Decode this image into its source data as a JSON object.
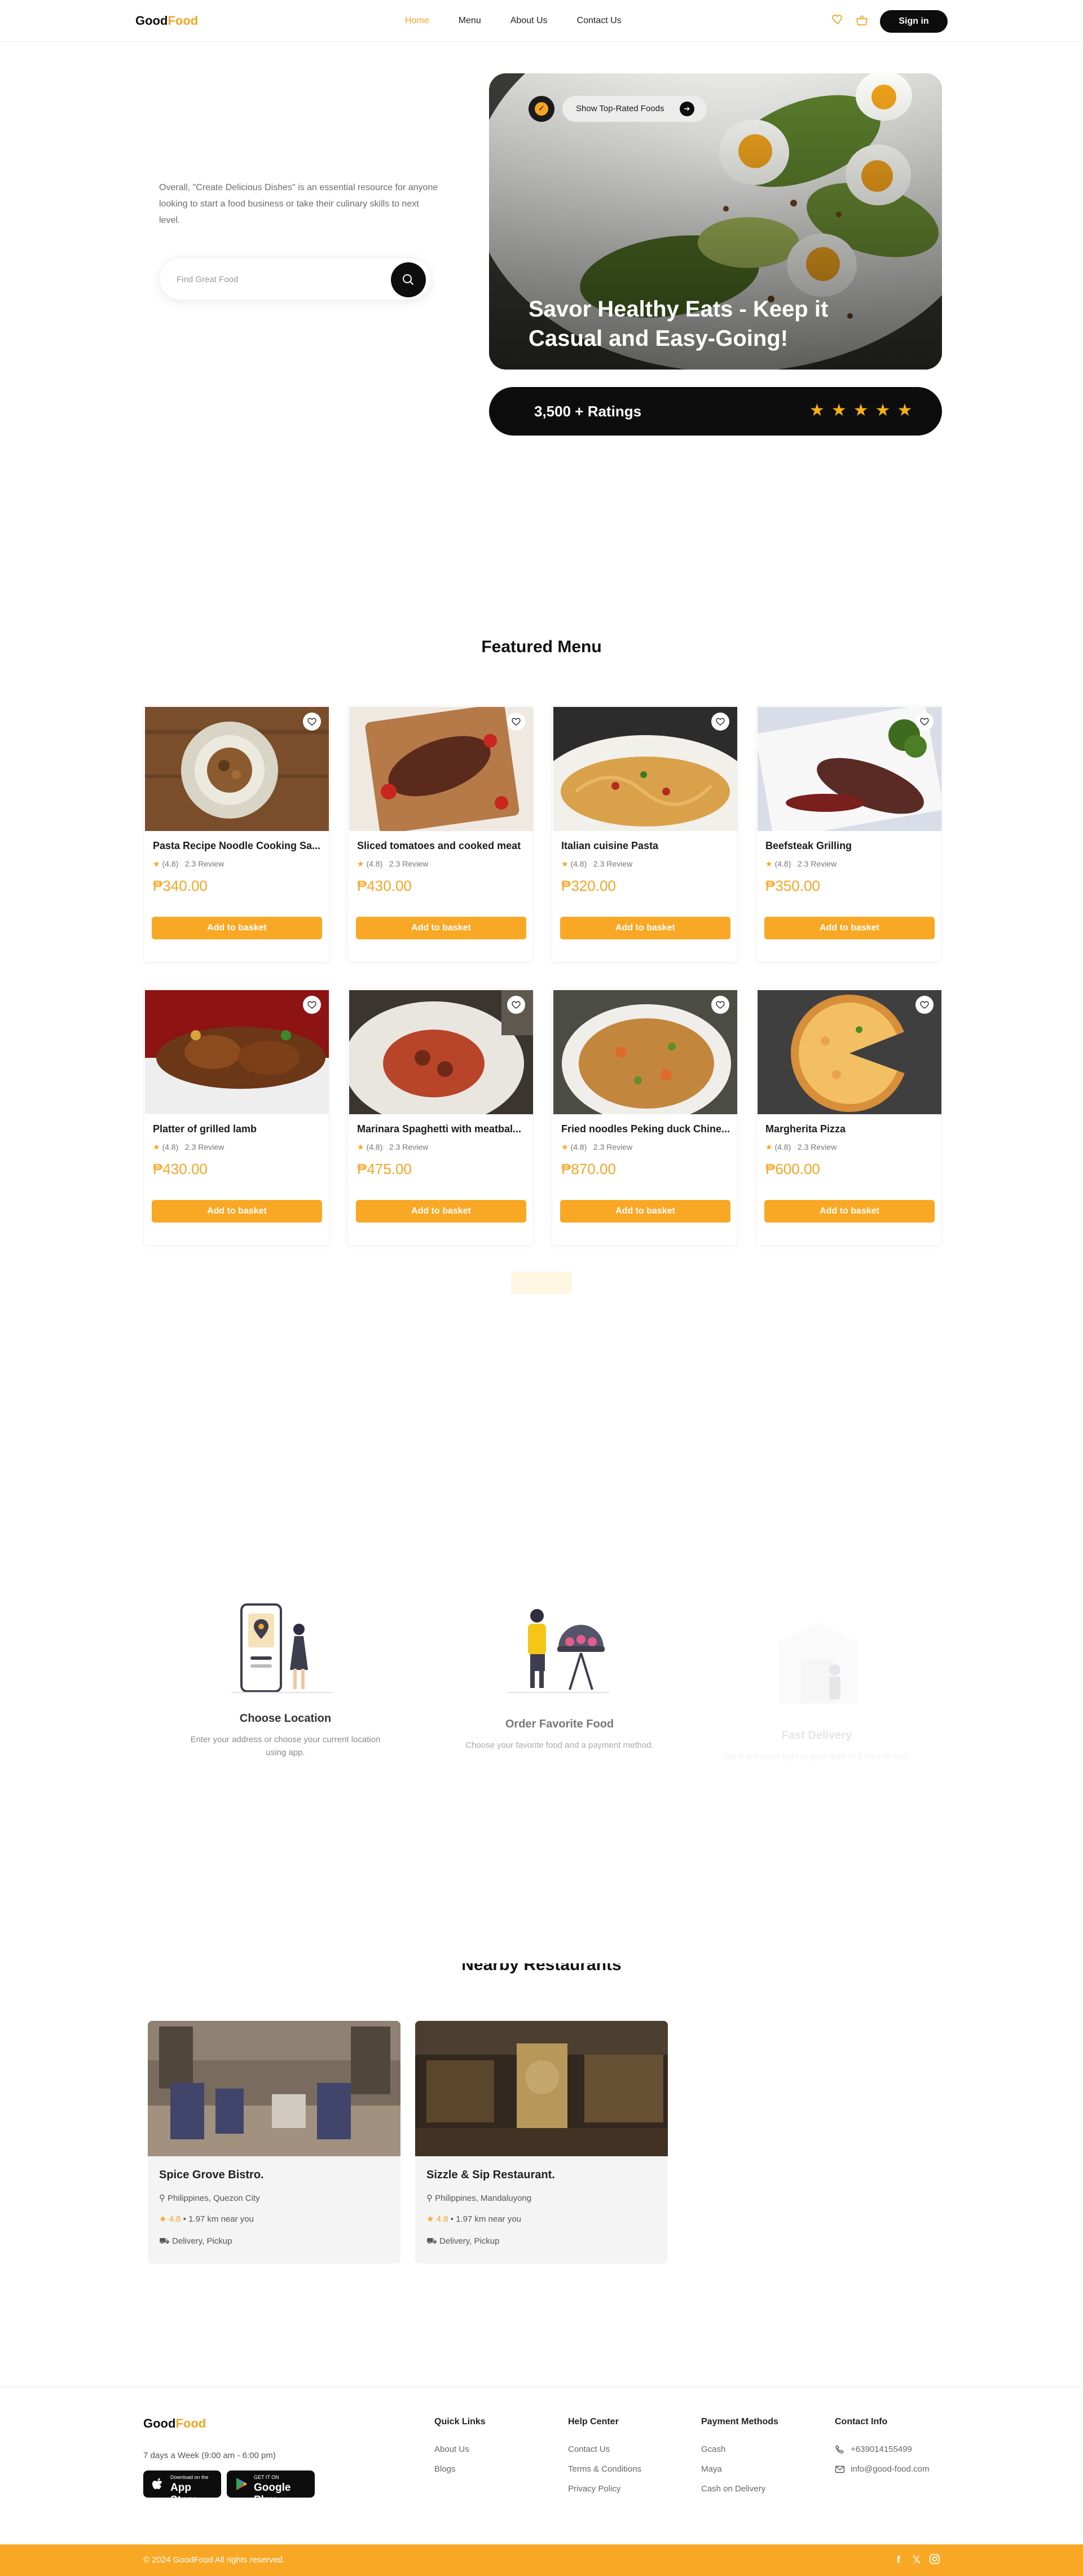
{
  "nav": {
    "logo_part1": "Good",
    "logo_part2": "Food",
    "links": [
      "Home",
      "Menu",
      "About Us",
      "Contact Us"
    ],
    "active_link": "Home",
    "signin_label": "Sign in"
  },
  "hero": {
    "description": "Overall, \"Create Delicious Dishes\" is an essential resource for anyone looking to start a food business or take their culinary skills to next level.",
    "search_placeholder": "Find Great Food",
    "pill_label": "Show Top-Rated Foods",
    "title": "Savor Healthy Eats - Keep it Casual and Easy-Going!",
    "ratings_label": "3,500 + Ratings",
    "stars": "★★★★★"
  },
  "menu": {
    "title": "Featured Menu",
    "add_label": "Add to basket",
    "rating_value": "(4.8)",
    "review_label": "2.3 Review",
    "items": [
      {
        "name": "Pasta Recipe Noodle Cooking Sa...",
        "price": "₱340.00"
      },
      {
        "name": "Sliced tomatoes and cooked meat",
        "price": "₱430.00"
      },
      {
        "name": "Italian cuisine Pasta",
        "price": "₱320.00"
      },
      {
        "name": "Beefsteak Grilling",
        "price": "₱350.00"
      },
      {
        "name": "Platter of grilled lamb",
        "price": "₱430.00"
      },
      {
        "name": "Marinara Spaghetti with meatbal...",
        "price": "₱475.00"
      },
      {
        "name": "Fried noodles Peking duck Chine...",
        "price": "₱870.00"
      },
      {
        "name": "Margherita Pizza",
        "price": "₱600.00"
      }
    ]
  },
  "steps": [
    {
      "title": "Choose Location",
      "desc": "Enter your address or choose your current location using app."
    },
    {
      "title": "Order Favorite Food",
      "desc": "Choose your favorite food and a payment method."
    },
    {
      "title": "Fast Delivery",
      "desc": "Get it delivered right to your door in 1 hour or less."
    }
  ],
  "restaurants": {
    "title": "Nearby Restaurants",
    "items": [
      {
        "name": "Spice Grove Bistro.",
        "location": "Philippines, Quezon City",
        "rating": "4.8",
        "distance": "• 1.97 km near you",
        "services": "Delivery, Pickup"
      },
      {
        "name": "Sizzle & Sip Restaurant.",
        "location": "Philippines, Mandaluyong",
        "rating": "4.8",
        "distance": "• 1.97 km near you",
        "services": "Delivery, Pickup"
      }
    ]
  },
  "footer": {
    "hours": "7 days a Week (9:00 am - 6:00 pm)",
    "appstore_small": "Download on the",
    "appstore_big": "App Store",
    "googleplay_small": "GET IT ON",
    "googleplay_big": "Google Play",
    "quick_links_title": "Quick Links",
    "quick_links": [
      "About Us",
      "Blogs"
    ],
    "help_title": "Help Center",
    "help_links": [
      "Contact Us",
      "Terms & Conditions",
      "Privacy Policy"
    ],
    "payment_title": "Payment Methods",
    "payment_links": [
      "Gcash",
      "Maya",
      "Cash on Delivery"
    ],
    "contact_title": "Contact Info",
    "phone": "+639014155499",
    "email": "info@good-food.com",
    "copyright": "© 2024 GoodFood All rights reserved."
  },
  "colors": {
    "accent": "#f5a524",
    "button": "#f9a825",
    "dark": "#0d0d0d"
  }
}
